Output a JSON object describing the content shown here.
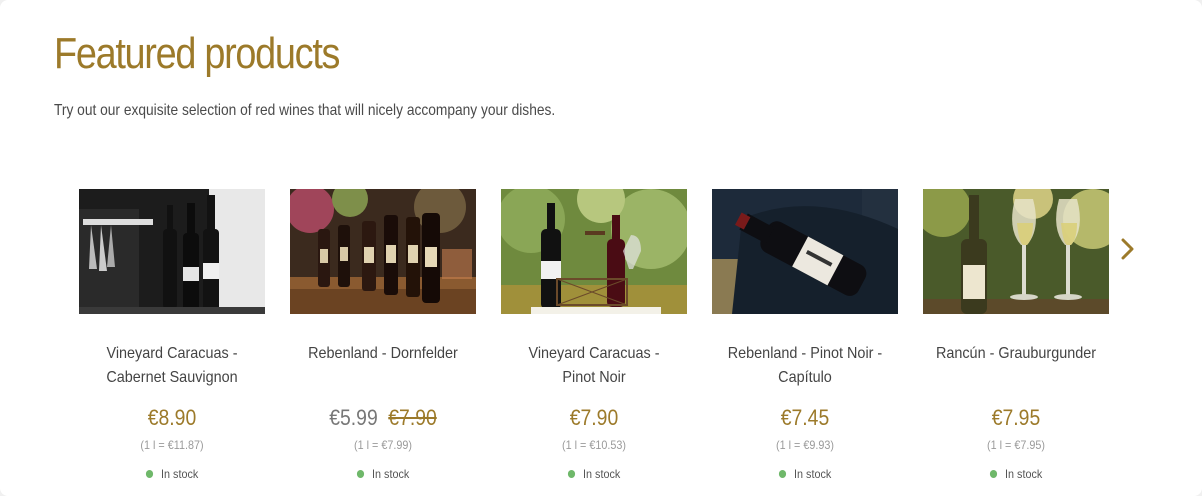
{
  "section": {
    "title": "Featured products",
    "subtitle": "Try out our exquisite selection of red wines that will nicely accompany your dishes."
  },
  "colors": {
    "accent": "#9c7a2a",
    "in_stock": "#6fb86a"
  },
  "products": [
    {
      "name": "Vineyard Caracuas - Cabernet Sauvignon",
      "price": "€8.90",
      "old_price": "",
      "unit_price": "(1 l = €11.87)",
      "stock": "In stock"
    },
    {
      "name": "Rebenland - Dornfelder",
      "price": "€5.99",
      "old_price": "€7.90",
      "unit_price": "(1 l = €7.99)",
      "stock": "In stock"
    },
    {
      "name": "Vineyard Caracuas - Pinot Noir",
      "price": "€7.90",
      "old_price": "",
      "unit_price": "(1 l = €10.53)",
      "stock": "In stock"
    },
    {
      "name": "Rebenland - Pinot Noir - Capítulo",
      "price": "€7.45",
      "old_price": "",
      "unit_price": "(1 l = €9.93)",
      "stock": "In stock"
    },
    {
      "name": "Rancún - Grauburgunder",
      "price": "€7.95",
      "old_price": "",
      "unit_price": "(1 l = €7.95)",
      "stock": "In stock"
    }
  ],
  "slider": {
    "next_icon": "chevron-right-icon"
  }
}
